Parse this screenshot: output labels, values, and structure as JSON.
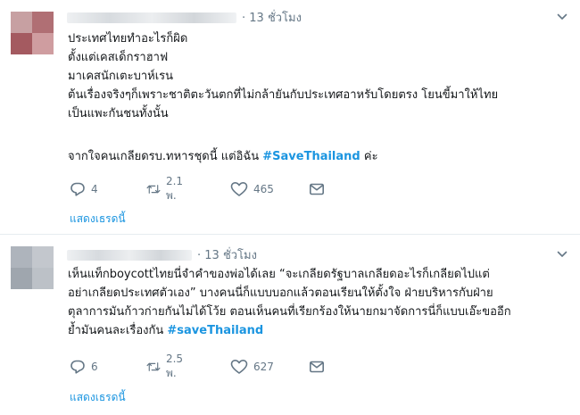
{
  "tweets": [
    {
      "time": "· 13 ชั่วโมง",
      "lines": [
        "ประเทศไทยทำอะไรก็ผิด",
        "ตั้งแต่เคสเด็กราฮาฟ",
        "มาเคสนักเตะบาห์เรน",
        "ต้นเรื่องจริงๆก็เพราะชาติตะวันตกที่ไม่กล้ายันกับประเทศอาหรับโดยตรง โยนขี้มาให้ไทย",
        "เป็นแพะกันชนทั้งนั้น"
      ],
      "closing_text": "จากใจคนเกลียดรบ.ทหารชุดนี้ แต่อิฉัน ",
      "hashtag": "#SaveThailand",
      "closing_suffix": " ค่ะ",
      "replies": "4",
      "retweets": "2.1 พ.",
      "likes": "465",
      "show_thread": "แสดงเธรดนี้",
      "avatar_colors": [
        "#c7a0a2",
        "#b06f74",
        "#a45a60",
        "#cf9da0"
      ]
    },
    {
      "time": "· 13 ชั่วโมง",
      "lines": [
        "เห็นแท็กboycottไทยนี่จำคำของพ่อได้เลย “จะเกลียดรัฐบาลเกลียดอะไรก็เกลียดไปแต่",
        "อย่าเกลียดประเทศตัวเอง” บางคนนี่ก็แบบบอกแล้วตอนเรียนให้ตั้งใจ ฝ่ายบริหารกับฝ่าย",
        "ตุลาการมันก้าวก่ายกันไม่ได้โว้ย ตอนเห็นคนที่เรียกร้องให้นายกมาจัดการนี่ก็แบบเอ๊ะขออีก"
      ],
      "last_line_prefix": "ย้ำมันคนละเรื่องกัน ",
      "hashtag": "#saveThailand",
      "replies": "6",
      "retweets": "2.5 พ.",
      "likes": "627",
      "show_thread": "แสดงเธรดนี้",
      "avatar_colors": [
        "#aeb4bc",
        "#c3c7cd",
        "#9fa6ae",
        "#bcc1c7"
      ]
    }
  ],
  "colors": {
    "text": "#14171a",
    "muted": "#657786",
    "link": "#1b95e0",
    "divider": "#e6ecf0"
  },
  "icons": [
    "reply-icon",
    "retweet-icon",
    "like-icon",
    "dm-icon",
    "chevron-down-icon"
  ]
}
